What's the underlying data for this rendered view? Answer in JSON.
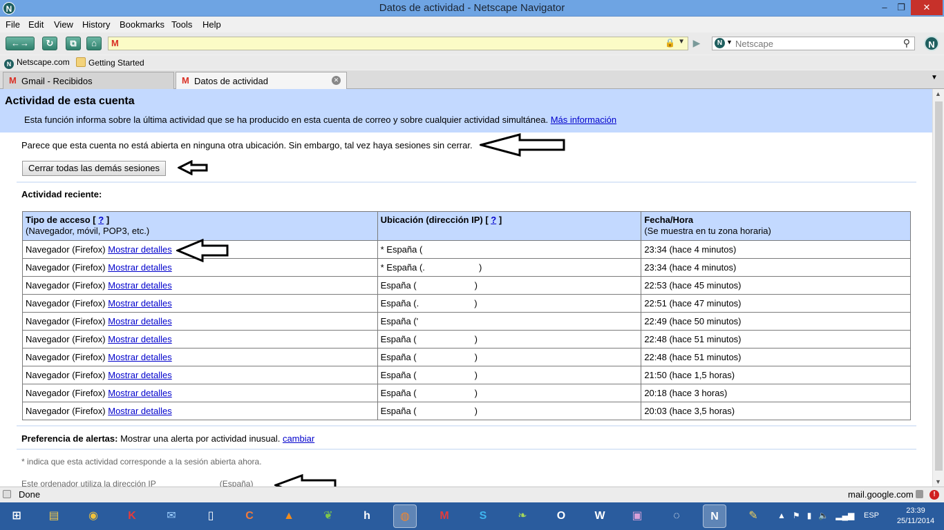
{
  "window": {
    "title": "Datos de actividad - Netscape Navigator",
    "minimize": "–",
    "maximize": "❐",
    "close": "✕"
  },
  "menu": [
    "File",
    "Edit",
    "View",
    "History",
    "Bookmarks",
    "Tools",
    "Help"
  ],
  "navbar": {
    "search_placeholder": "Netscape"
  },
  "bookmarks": [
    {
      "label": "Netscape.com"
    },
    {
      "label": "Getting Started"
    }
  ],
  "tabs": [
    {
      "label": "Gmail - Recibidos",
      "active": false
    },
    {
      "label": "Datos de actividad",
      "active": true
    }
  ],
  "page": {
    "heading": "Actividad de esta cuenta",
    "description": "Esta función informa sobre la última actividad que se ha producido en esta cuenta de correo y sobre cualquier actividad simultánea.",
    "more_info": "Más información",
    "status_message": "Parece que esta cuenta no está abierta en ninguna otra ubicación. Sin embargo, tal vez haya sesiones sin cerrar.",
    "close_sessions_button": "Cerrar todas las demás sesiones",
    "recent_title": "Actividad reciente:",
    "table": {
      "headers": [
        {
          "title": "Tipo de acceso",
          "help": "?",
          "sub": "(Navegador, móvil, POP3, etc.)"
        },
        {
          "title": "Ubicación (dirección IP)",
          "help": "?",
          "sub": ""
        },
        {
          "title": "Fecha/Hora",
          "help": "",
          "sub": "(Se muestra en tu zona horaria)"
        }
      ],
      "rows": [
        {
          "access": "Navegador (Firefox)",
          "details": "Mostrar detalles",
          "location": "* España (",
          "location_end": "",
          "time": "23:34 (hace 4 minutos)"
        },
        {
          "access": "Navegador (Firefox)",
          "details": "Mostrar detalles",
          "location": "* España (.",
          "location_end": ")",
          "time": "23:34 (hace 4 minutos)"
        },
        {
          "access": "Navegador (Firefox)",
          "details": "Mostrar detalles",
          "location": "España (",
          "location_end": ")",
          "time": "22:53 (hace 45 minutos)"
        },
        {
          "access": "Navegador (Firefox)",
          "details": "Mostrar detalles",
          "location": "España (.",
          "location_end": ")",
          "time": "22:51 (hace 47 minutos)"
        },
        {
          "access": "Navegador (Firefox)",
          "details": "Mostrar detalles",
          "location": "España ('",
          "location_end": "",
          "time": "22:49 (hace 50 minutos)"
        },
        {
          "access": "Navegador (Firefox)",
          "details": "Mostrar detalles",
          "location": "España (",
          "location_end": ")",
          "time": "22:48 (hace 51 minutos)"
        },
        {
          "access": "Navegador (Firefox)",
          "details": "Mostrar detalles",
          "location": "España (",
          "location_end": ")",
          "time": "22:48 (hace 51 minutos)"
        },
        {
          "access": "Navegador (Firefox)",
          "details": "Mostrar detalles",
          "location": "España (",
          "location_end": ")",
          "time": "21:50 (hace 1,5 horas)"
        },
        {
          "access": "Navegador (Firefox)",
          "details": "Mostrar detalles",
          "location": "España (",
          "location_end": ")",
          "time": "20:18 (hace 3 horas)"
        },
        {
          "access": "Navegador (Firefox)",
          "details": "Mostrar detalles",
          "location": "España (",
          "location_end": ")",
          "time": "20:03 (hace 3,5 horas)"
        }
      ]
    },
    "alerts_label": "Preferencia de alertas:",
    "alerts_text": "Mostrar una alerta por actividad inusual.",
    "alerts_link": "cambiar",
    "note": "* indica que esta actividad corresponde a la sesión abierta ahora.",
    "ip_text": "Este ordenador utiliza la dirección IP",
    "ip_country": "(España)"
  },
  "statusbar": {
    "status": "Done",
    "host": "mail.google.com"
  },
  "taskbar": {
    "apps": [
      "start-icon",
      "file-explorer-icon",
      "chrome-icon",
      "kaspersky-icon",
      "thunderbird-icon",
      "notepad-icon",
      "ccleaner-icon",
      "vlc-icon",
      "evernote-icon",
      "hootsuite-icon",
      "firefox-icon",
      "gmail-icon",
      "skype-icon",
      "feedreader-icon",
      "outlook-icon",
      "word-icon",
      "youtube-downloader-icon",
      "cyberlink-icon",
      "netscape-icon",
      "paint-icon"
    ],
    "lang": "ESP",
    "time": "23:39",
    "date": "25/11/2014"
  }
}
